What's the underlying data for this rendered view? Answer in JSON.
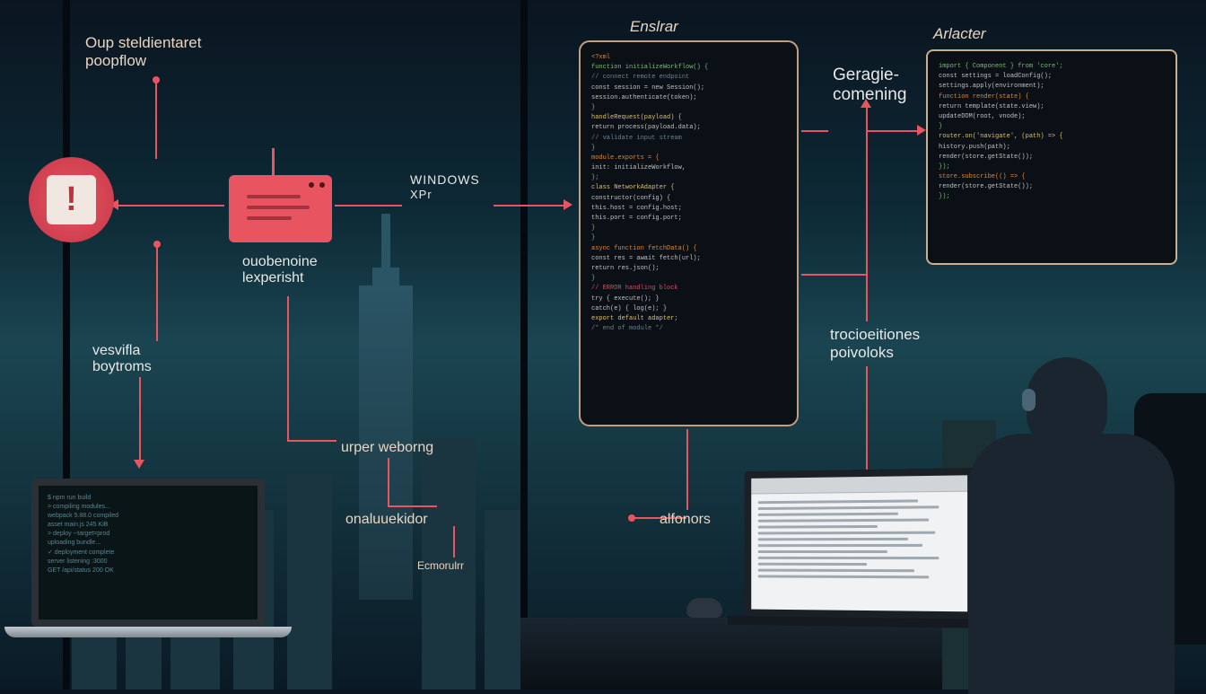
{
  "labels": {
    "topLeft1": "Oup steldientaret",
    "topLeft2": "poopflow",
    "centerTop": "Enslrar",
    "rightTop": "Arlacter",
    "rightMid1": "Geragie-",
    "rightMid2": "comening",
    "windows": "WINDOWS",
    "xp": "XPr",
    "routerLabel1": "ouobenoine",
    "routerLabel2": "lexperisht",
    "leftMid1": "vesvifla",
    "leftMid2": "boytroms",
    "bottomMid1": "urper weborng",
    "bottomMid2": "onaluuekidor",
    "bottomMid3": "Ecmorulrr",
    "bottomRight1": "alfonors",
    "rightLabel1": "trocioeitiones",
    "rightLabel2": "poivoloks"
  },
  "alert": {
    "symbol": "!"
  },
  "codeCenter": {
    "lines": [
      {
        "cls": "cl-orange",
        "txt": "<?xml"
      },
      {
        "cls": "cl-green",
        "txt": "function initializeWorkflow() {"
      },
      {
        "cls": "cl-gray",
        "txt": "  // connect remote endpoint"
      },
      {
        "cls": "cl-white",
        "txt": "  const session = new Session();"
      },
      {
        "cls": "cl-white",
        "txt": "  session.authenticate(token);"
      },
      {
        "cls": "cl-green",
        "txt": "}"
      },
      {
        "cls": "cl-yellow",
        "txt": "handleRequest(payload) {"
      },
      {
        "cls": "cl-white",
        "txt": "  return process(payload.data);"
      },
      {
        "cls": "cl-gray",
        "txt": "  // validate input stream"
      },
      {
        "cls": "cl-green",
        "txt": "}"
      },
      {
        "cls": "cl-orange",
        "txt": "module.exports = {"
      },
      {
        "cls": "cl-white",
        "txt": "  init: initializeWorkflow,"
      },
      {
        "cls": "cl-green",
        "txt": "};"
      },
      {
        "cls": "cl-yellow",
        "txt": "class NetworkAdapter {"
      },
      {
        "cls": "cl-white",
        "txt": "  constructor(config) {"
      },
      {
        "cls": "cl-white",
        "txt": "    this.host = config.host;"
      },
      {
        "cls": "cl-white",
        "txt": "    this.port = config.port;"
      },
      {
        "cls": "cl-green",
        "txt": "  }"
      },
      {
        "cls": "cl-green",
        "txt": "}"
      },
      {
        "cls": "cl-orange",
        "txt": "async function fetchData() {"
      },
      {
        "cls": "cl-white",
        "txt": "  const res = await fetch(url);"
      },
      {
        "cls": "cl-white",
        "txt": "  return res.json();"
      },
      {
        "cls": "cl-green",
        "txt": "}"
      },
      {
        "cls": "cl-red",
        "txt": "// ERROR handling block"
      },
      {
        "cls": "cl-white",
        "txt": "try { execute(); }"
      },
      {
        "cls": "cl-white",
        "txt": "catch(e) { log(e); }"
      },
      {
        "cls": "cl-yellow",
        "txt": "export default adapter;"
      },
      {
        "cls": "cl-gray",
        "txt": "/* end of module */"
      }
    ]
  },
  "codeRight": {
    "lines": [
      {
        "cls": "cl-green",
        "txt": "import { Component } from 'core';"
      },
      {
        "cls": "cl-white",
        "txt": "const settings = loadConfig();"
      },
      {
        "cls": "cl-white",
        "txt": "settings.apply(environment);"
      },
      {
        "cls": "cl-gray",
        "txt": ""
      },
      {
        "cls": "cl-orange",
        "txt": "function render(state) {"
      },
      {
        "cls": "cl-white",
        "txt": "  return template(state.view);"
      },
      {
        "cls": "cl-white",
        "txt": "  updateDOM(root, vnode);"
      },
      {
        "cls": "cl-green",
        "txt": "}"
      },
      {
        "cls": "cl-yellow",
        "txt": "router.on('navigate', (path) => {"
      },
      {
        "cls": "cl-white",
        "txt": "  history.push(path);"
      },
      {
        "cls": "cl-white",
        "txt": "  render(store.getState());"
      },
      {
        "cls": "cl-green",
        "txt": "});"
      },
      {
        "cls": "cl-gray",
        "txt": ""
      },
      {
        "cls": "cl-orange",
        "txt": "store.subscribe(() => {"
      },
      {
        "cls": "cl-white",
        "txt": "  render(store.getState());"
      },
      {
        "cls": "cl-green",
        "txt": "});"
      }
    ]
  },
  "laptopLeft": {
    "lines": [
      "$ npm run build",
      "> compiling modules...",
      "",
      "webpack 5.88.0 compiled",
      "asset main.js 245 KiB",
      "",
      "> deploy --target=prod",
      "uploading bundle...",
      "",
      "✓ deployment complete",
      "server listening :3000",
      "",
      "GET /api/status 200 OK"
    ]
  }
}
